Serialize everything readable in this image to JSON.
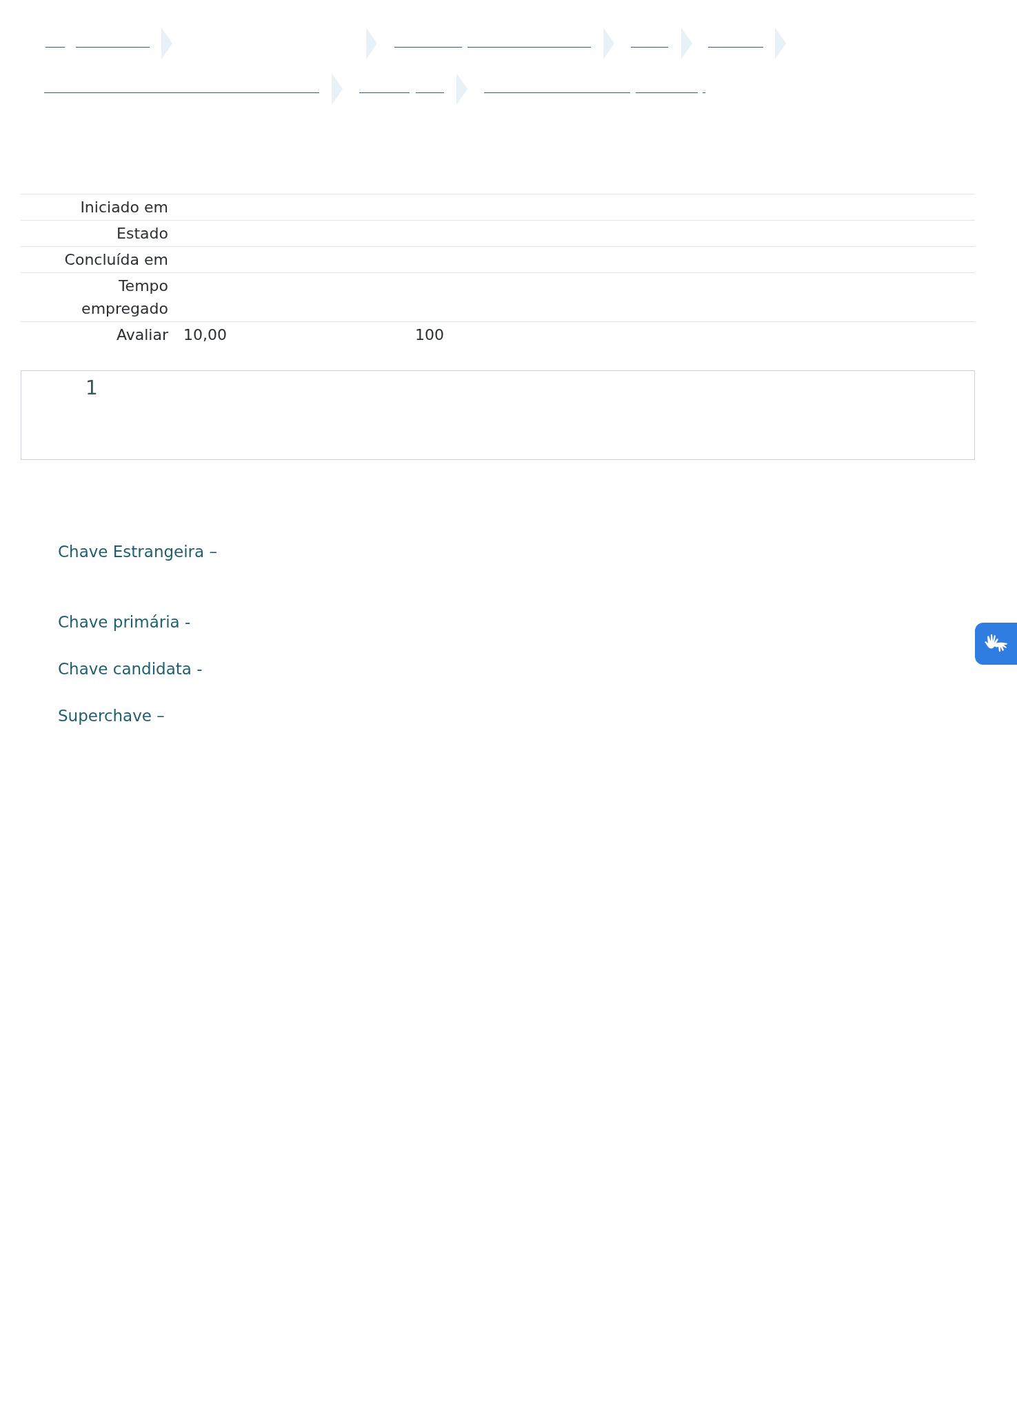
{
  "summary": [
    {
      "label": "Iniciado em"
    },
    {
      "label": "Estado"
    },
    {
      "label": "Concluída em"
    },
    {
      "label": "Tempo empregado"
    },
    {
      "label": "Avaliar",
      "cells": [
        "10,00",
        "100"
      ]
    }
  ],
  "question": {
    "number": "1"
  },
  "terms": [
    "Chave Estrangeira –",
    "Chave primária -",
    "Chave candidata -",
    "Superchave –"
  ]
}
